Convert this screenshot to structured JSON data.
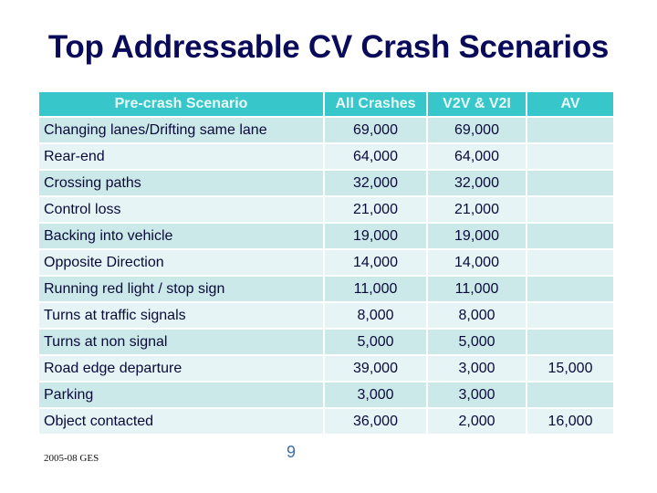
{
  "title": "Top Addressable CV Crash Scenarios",
  "table": {
    "headers": [
      "Pre-crash Scenario",
      "All Crashes",
      "V2V & V2I",
      "AV"
    ],
    "rows": [
      {
        "scenario": "Changing lanes/Drifting same lane",
        "all": "69,000",
        "v2v": "69,000",
        "av": ""
      },
      {
        "scenario": "Rear-end",
        "all": "64,000",
        "v2v": "64,000",
        "av": ""
      },
      {
        "scenario": "Crossing paths",
        "all": "32,000",
        "v2v": "32,000",
        "av": ""
      },
      {
        "scenario": "Control loss",
        "all": "21,000",
        "v2v": "21,000",
        "av": ""
      },
      {
        "scenario": "Backing into vehicle",
        "all": "19,000",
        "v2v": "19,000",
        "av": ""
      },
      {
        "scenario": "Opposite Direction",
        "all": "14,000",
        "v2v": "14,000",
        "av": ""
      },
      {
        "scenario": "Running red light / stop sign",
        "all": "11,000",
        "v2v": "11,000",
        "av": ""
      },
      {
        "scenario": "Turns at traffic signals",
        "all": "8,000",
        "v2v": "8,000",
        "av": ""
      },
      {
        "scenario": "Turns at non signal",
        "all": "5,000",
        "v2v": "5,000",
        "av": ""
      },
      {
        "scenario": "Road edge departure",
        "all": "39,000",
        "v2v": "3,000",
        "av": "15,000"
      },
      {
        "scenario": "Parking",
        "all": "3,000",
        "v2v": "3,000",
        "av": ""
      },
      {
        "scenario": "Object contacted",
        "all": "36,000",
        "v2v": "2,000",
        "av": "16,000"
      }
    ]
  },
  "footer": {
    "source": "2005-08 GES",
    "page_number": "9"
  },
  "colors": {
    "title": "#0a0a5a",
    "header_bg": "#37c6c9",
    "row_odd": "#cce9ea",
    "row_even": "#e6f4f5"
  }
}
